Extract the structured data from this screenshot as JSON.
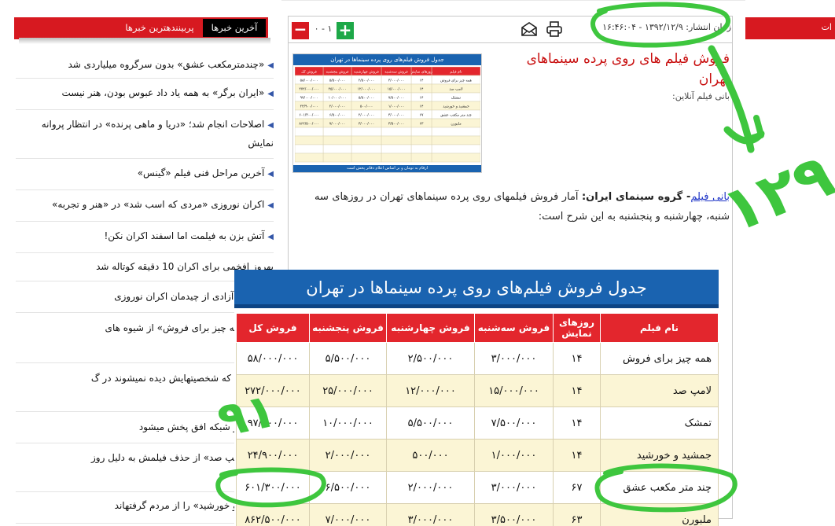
{
  "left_panel": {
    "tab_latest": "آخرین خبرها",
    "tab_popular": "پربینندهترین خبرها",
    "items": [
      "«چندمترمکعب عشق» بدون سرگروه میلیاردی شد",
      "«ایران برگر» به همه یاد داد عبوس بودن، هنر نیست",
      "اصلاحات انجام شد؛ «دریا و ماهی پرنده» در انتظار پروانه نمایش",
      "آخرین مراحل فنی فیلم «گینس»",
      "اکران نوروزی «مردی که اسب شد» در «هنر و تجربه»",
      "آتش بزن به فیلمت اما اسفند اکران نکن!",
      "بهروز افخمی برای اکران 10 دقیقه کوتاله شد",
      "دیر سینما آزادی از چیدمان اکران نوروزی",
      "کننده «همه چیز برای فروش» از شیوه های",
      "می ایرانی که شخصیتهایش دیده نمیشوند در گ",
      "زندگی» از شبکه افق پخش میشود",
      "کننده «لامپ صد» از حذف فیلمش به دلیل روز",
      "«جمشید و خورشید» را از مردم گرفتهاند"
    ]
  },
  "right_panel": {
    "header_fragment": "ات"
  },
  "toolbar": {
    "published_label": "زمان انتشار:",
    "published_value": "۱۳۹۲/۱۲/۹ - ۱۶:۴۶:۰۴",
    "counter": "۰ - ۱"
  },
  "article": {
    "title": "فروش فیلم های روی پرده سینماهای تهران",
    "source": "بانی فیلم آنلاین:",
    "body_source": "بانی فیلم",
    "body_group": "- گروه سینمای ایران:",
    "body_text": "آمار فروش فیلمهای روی پرده سینماهای تهران در روزهای سه شنبه، چهارشنبه و پنجشنبه به این شرح است:"
  },
  "thumbnail": {
    "title": "جدول فروش فیلم‌های روی پرده سینماها در تهران",
    "footer": "ارقام به تومان و بر اساس اعلام دفاتر پخش است"
  },
  "table": {
    "title": "جدول فروش فیلم‌های روی پرده سینماها در تهران",
    "headers": [
      "نام فیلم",
      "روزهای نمایش",
      "فروش سه‌شنبه",
      "فروش چهارشنبه",
      "فروش پنجشنبه",
      "فروش کل"
    ],
    "rows": [
      [
        "همه چیز برای فروش",
        "۱۴",
        "۳/۰۰۰/۰۰۰",
        "۲/۵۰۰/۰۰۰",
        "۵/۵۰۰/۰۰۰",
        "۵۸/۰۰۰/۰۰۰"
      ],
      [
        "لامپ صد",
        "۱۴",
        "۱۵/۰۰۰/۰۰۰",
        "۱۲/۰۰۰/۰۰۰",
        "۲۵/۰۰۰/۰۰۰",
        "۲۷۲/۰۰۰/۰۰۰"
      ],
      [
        "تمشک",
        "۱۴",
        "۷/۵۰۰/۰۰۰",
        "۵/۵۰۰/۰۰۰",
        "۱۰/۰۰۰/۰۰۰",
        "۹۷/۰۰۰/۰۰۰"
      ],
      [
        "جمشید و خورشید",
        "۱۴",
        "۱/۰۰۰/۰۰۰",
        "۵۰۰/۰۰۰",
        "۲/۰۰۰/۰۰۰",
        "۲۴/۹۰۰/۰۰۰"
      ],
      [
        "چند متر مکعب عشق",
        "۶۷",
        "۳/۰۰۰/۰۰۰",
        "۲/۰۰۰/۰۰۰",
        "۶/۵۰۰/۰۰۰",
        "۶۰۱/۳۰۰/۰۰۰"
      ],
      [
        "ملبورن",
        "۶۳",
        "۳/۵۰۰/۰۰۰",
        "۳/۰۰۰/۰۰۰",
        "۷/۰۰۰/۰۰۰",
        "۸۶۲/۵۰۰/۰۰۰"
      ]
    ]
  },
  "annotations": {
    "number_129": "۱۲۹",
    "number_91": "۹۱"
  },
  "colors": {
    "brand_red": "#d71920",
    "table_blue": "#1a63b0",
    "annotation_green": "#3ec63e",
    "link_blue": "#1a31c6"
  },
  "icons": [
    "print-icon",
    "email-icon",
    "plus-icon",
    "minus-icon",
    "bullet-icon"
  ]
}
